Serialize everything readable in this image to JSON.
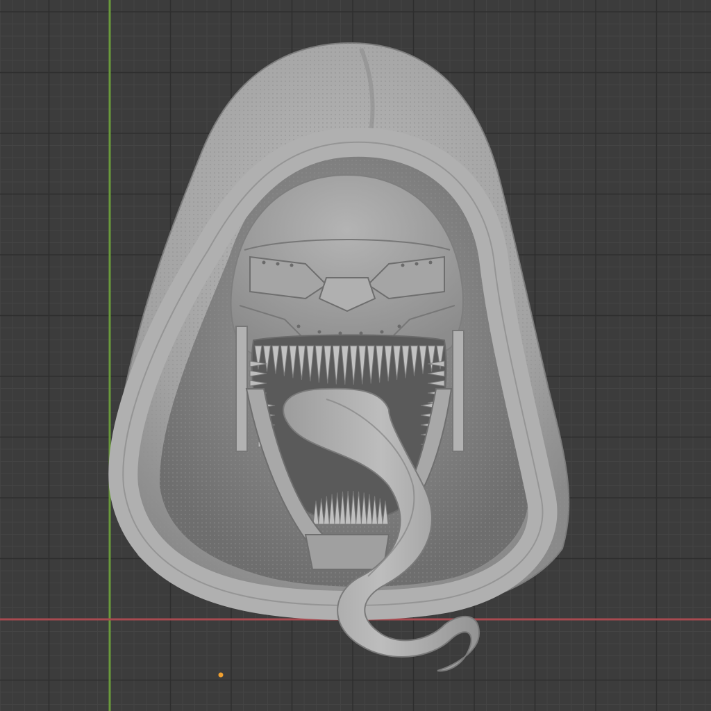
{
  "viewport": {
    "background_color": "#3c3c3c",
    "grid_minor_color": "#444444",
    "grid_major_color": "#2e2e2e",
    "y_axis_color": "#6a9a3c",
    "x_axis_color": "#a84a50",
    "origin_color": "#f0a030",
    "model_color": "#a6a6a6"
  },
  "model": {
    "name": "",
    "description_icon": "hooded-symbiote-sculpt"
  }
}
